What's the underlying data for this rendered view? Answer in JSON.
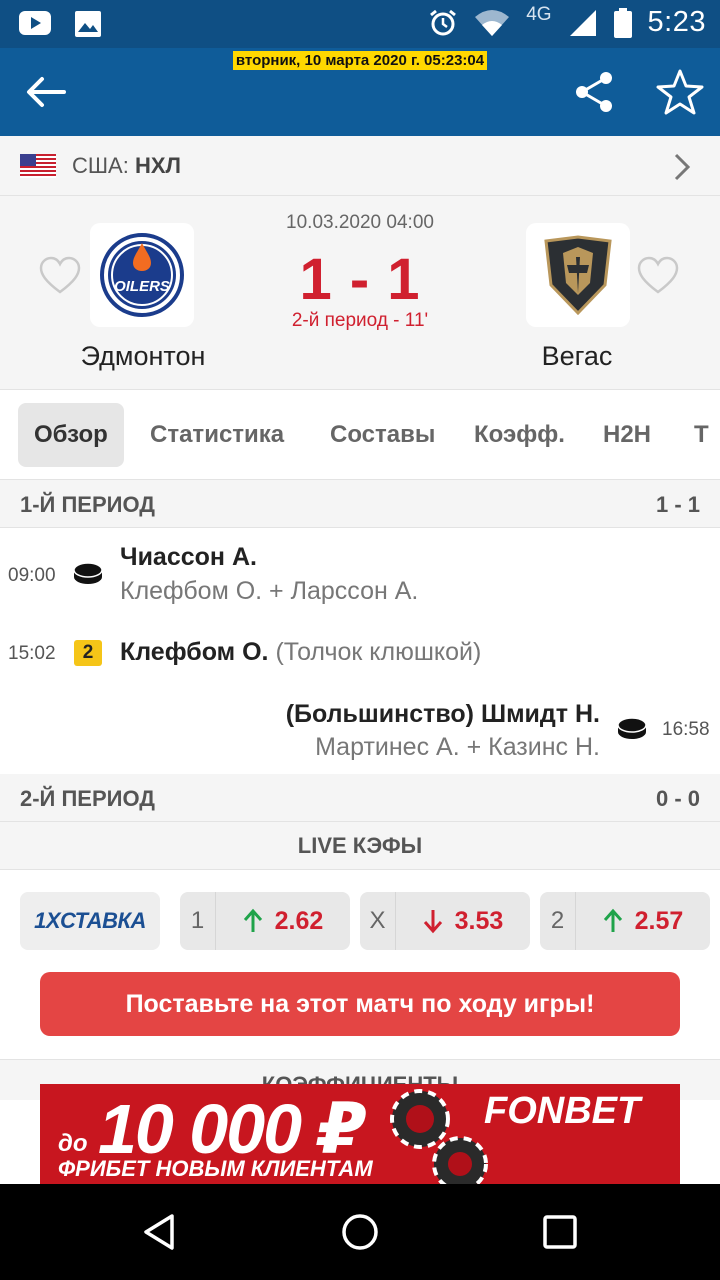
{
  "status_bar": {
    "time": "5:23",
    "network": "4G",
    "icons": [
      "youtube-icon",
      "image-icon",
      "alarm-icon",
      "wifi-icon",
      "signal-icon",
      "battery-icon"
    ]
  },
  "app_bar": {
    "datetime": "вторник, 10 марта 2020 г. 05:23:04",
    "icons": [
      "back-arrow-icon",
      "share-icon",
      "star-icon"
    ]
  },
  "league": {
    "country": "США:",
    "name": "НХЛ",
    "flag": "us-flag-icon"
  },
  "match": {
    "date": "10.03.2020 04:00",
    "score": "1 - 1",
    "status": "2-й период - 11'",
    "home": {
      "name": "Эдмонтон",
      "logo": "oilers-logo",
      "logo_text": "OILERS"
    },
    "away": {
      "name": "Вегас",
      "logo": "golden-knights-logo"
    }
  },
  "tabs": [
    {
      "label": "Обзор",
      "active": true
    },
    {
      "label": "Статистика"
    },
    {
      "label": "Составы"
    },
    {
      "label": "Коэфф."
    },
    {
      "label": "H2H"
    },
    {
      "label": "Т"
    }
  ],
  "periods": [
    {
      "title": "1-Й ПЕРИОД",
      "score": "1 - 1",
      "events": [
        {
          "time": "09:00",
          "type": "goal",
          "side": "home",
          "player": "Чиассон А.",
          "assists": "Клефбом О. + Ларссон А."
        },
        {
          "time": "15:02",
          "type": "penalty",
          "minutes": "2",
          "side": "home",
          "player": "Клефбом О.",
          "note": "(Толчок клюшкой)"
        },
        {
          "time": "16:58",
          "type": "goal",
          "side": "away",
          "player": "(Большинство) Шмидт Н.",
          "assists": "Мартинес А. + Казинс Н."
        }
      ]
    },
    {
      "title": "2-Й ПЕРИОД",
      "score": "0 - 0"
    }
  ],
  "live_odds": {
    "header": "LIVE КЭФЫ",
    "bookmaker": "1XСТАВКА",
    "odds": [
      {
        "label": "1",
        "value": "2.62",
        "trend": "up"
      },
      {
        "label": "X",
        "value": "3.53",
        "trend": "down"
      },
      {
        "label": "2",
        "value": "2.57",
        "trend": "up"
      }
    ],
    "bet_button": "Поставьте на этот матч по ходу игры!"
  },
  "coefficients_header": "КОЭФФИЦИЕНТЫ",
  "ad": {
    "prefix": "до",
    "amount": "10 000 ₽",
    "subtitle": "ФРИБЕТ НОВЫМ КЛИЕНТАМ",
    "brand": "FONBET"
  },
  "colors": {
    "primary": "#0f5c99",
    "status_bar": "#0f4f84",
    "score_red": "#d0202f",
    "trend_up": "#1fa34a",
    "trend_down": "#d0202f",
    "bet_button": "#e44544",
    "ad_background": "#c8161f",
    "highlight": "#ffd800"
  }
}
